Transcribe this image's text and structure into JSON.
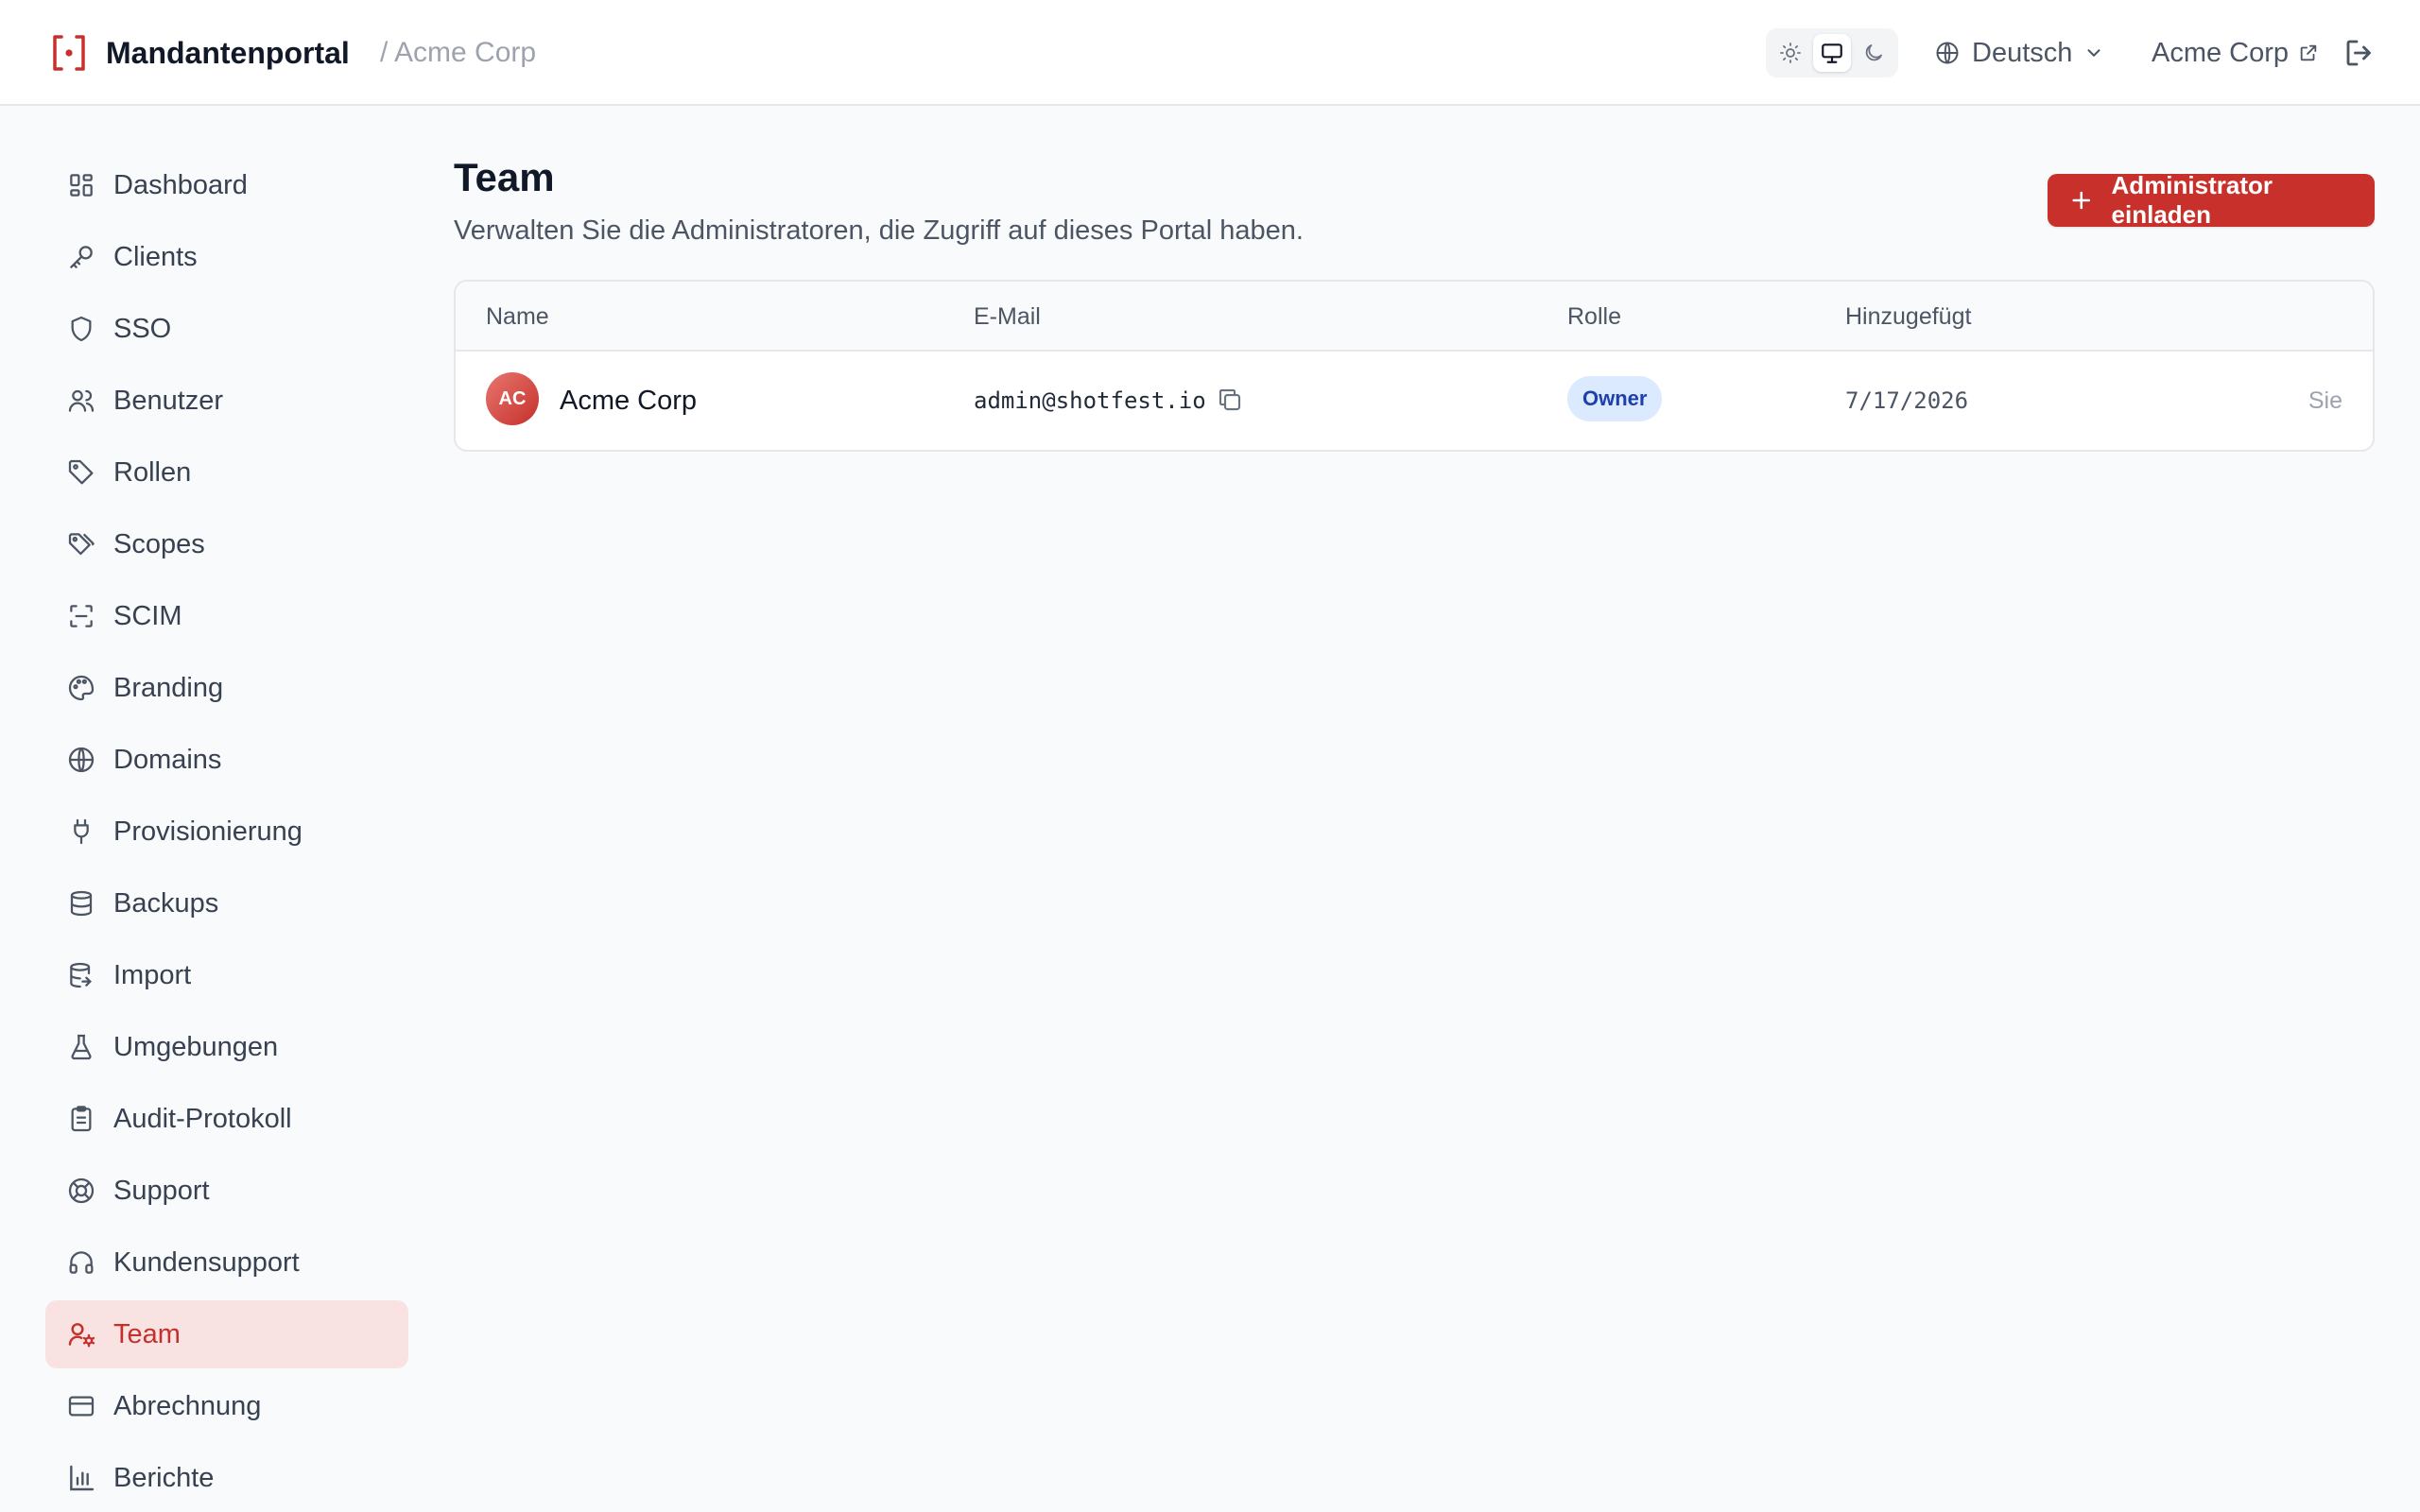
{
  "header": {
    "app_name": "Mandantenportal",
    "breadcrumb": "/ Acme Corp",
    "language": "Deutsch",
    "tenant_link": "Acme Corp",
    "theme_options": [
      "sun-icon",
      "monitor-icon",
      "moon-icon"
    ],
    "active_theme": "monitor-icon"
  },
  "sidebar": {
    "items": [
      {
        "label": "Dashboard",
        "icon": "dashboard-icon"
      },
      {
        "label": "Clients",
        "icon": "key-icon"
      },
      {
        "label": "SSO",
        "icon": "shield-icon"
      },
      {
        "label": "Benutzer",
        "icon": "users-icon"
      },
      {
        "label": "Rollen",
        "icon": "tag-icon"
      },
      {
        "label": "Scopes",
        "icon": "tags-icon"
      },
      {
        "label": "SCIM",
        "icon": "scan-icon"
      },
      {
        "label": "Branding",
        "icon": "palette-icon"
      },
      {
        "label": "Domains",
        "icon": "globe-icon"
      },
      {
        "label": "Provisionierung",
        "icon": "plug-icon"
      },
      {
        "label": "Backups",
        "icon": "database-icon"
      },
      {
        "label": "Import",
        "icon": "database-import-icon"
      },
      {
        "label": "Umgebungen",
        "icon": "flask-icon"
      },
      {
        "label": "Audit-Protokoll",
        "icon": "clipboard-icon"
      },
      {
        "label": "Support",
        "icon": "lifebuoy-icon"
      },
      {
        "label": "Kundensupport",
        "icon": "headphones-icon"
      },
      {
        "label": "Team",
        "icon": "user-cog-icon"
      },
      {
        "label": "Abrechnung",
        "icon": "credit-card-icon"
      },
      {
        "label": "Berichte",
        "icon": "bar-chart-icon"
      }
    ],
    "active": "Team"
  },
  "main": {
    "title": "Team",
    "subtitle": "Verwalten Sie die Administratoren, die Zugriff auf dieses Portal haben.",
    "invite_label": "Administrator einladen",
    "table": {
      "columns": [
        "Name",
        "E-Mail",
        "Rolle",
        "Hinzugefügt"
      ],
      "rows": [
        {
          "initials": "AC",
          "name": "Acme Corp",
          "email": "admin@shotfest.io",
          "role": "Owner",
          "added": "7/17/2026",
          "note": "Sie"
        }
      ]
    }
  },
  "colors": {
    "accent": "#c8312b",
    "active_bg": "#f9e3e2",
    "badge_bg": "#dbeafe",
    "badge_text": "#1e40af"
  }
}
